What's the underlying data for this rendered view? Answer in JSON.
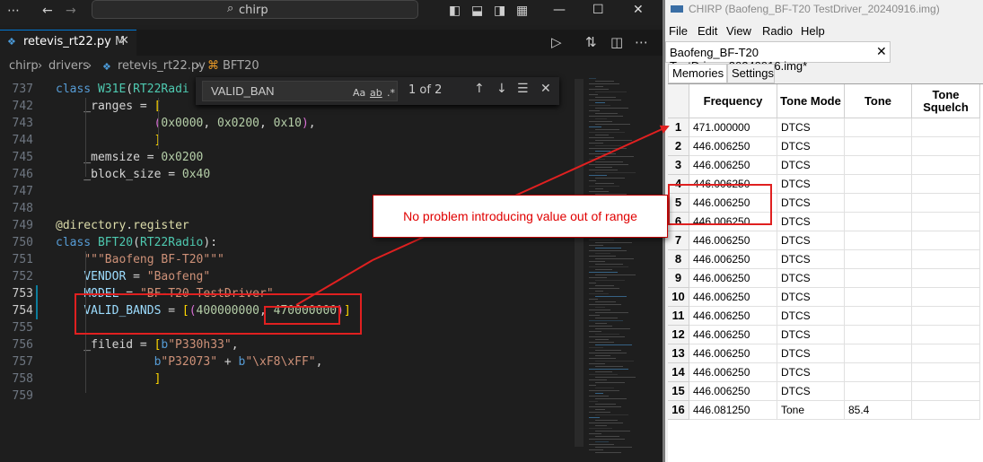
{
  "vscode": {
    "command_center": "chirp",
    "tab": {
      "name": "retevis_rt22.py",
      "modified": "M"
    },
    "breadcrumb": [
      "chirp",
      "drivers",
      "retevis_rt22.py",
      "BFT20"
    ],
    "find": {
      "value": "VALID_BAN",
      "opt_case": "Aa",
      "opt_word": "ab",
      "opt_regex": ".*",
      "count": "1 of 2"
    },
    "lines": [
      {
        "num": "737",
        "html": "<span class='k'>class</span> <span class='cl'>W31E</span>(<span class='cl'>RT22Radi</span>"
      },
      {
        "num": "742",
        "html": "    _ranges = <span class='y'>[</span>"
      },
      {
        "num": "743",
        "html": "              <span class='p'>(</span><span class='n'>0x0000</span>, <span class='n'>0x0200</span>, <span class='n'>0x10</span><span class='p'>)</span>,"
      },
      {
        "num": "744",
        "html": "              <span class='y'>]</span>"
      },
      {
        "num": "745",
        "html": "    _memsize = <span class='n'>0x0200</span>"
      },
      {
        "num": "746",
        "html": "    _block_size = <span class='n'>0x40</span>"
      },
      {
        "num": "747",
        "html": ""
      },
      {
        "num": "748",
        "html": ""
      },
      {
        "num": "749",
        "html": "<span class='dec'>@directory</span>.<span class='dec'>register</span>"
      },
      {
        "num": "750",
        "html": "<span class='k'>class</span> <span class='cl'>BFT20</span>(<span class='cl'>RT22Radio</span>):"
      },
      {
        "num": "751",
        "html": "    <span class='s'>\"\"\"Baofeng BF-T20\"\"\"</span>"
      },
      {
        "num": "752",
        "html": "    <span class='v'>VENDOR</span> = <span class='s'>\"Baofeng\"</span>"
      },
      {
        "num": "753",
        "html": "    <span class='v'>MODEL</span> = <span class='s'>\"BF-T20 TestDriver\"</span>"
      },
      {
        "num": "754",
        "html": "    <span class='v'>VALID_BANDS</span> = <span class='y'>[</span><span class='p'>(</span><span class='n'>400000000</span>, <span class='n'>470000000</span><span class='p'>)</span><span class='y'>]</span>"
      },
      {
        "num": "755",
        "html": ""
      },
      {
        "num": "756",
        "html": "    _fileid = <span class='y'>[</span><span class='k'>b</span><span class='s'>\"P330h33\"</span>,"
      },
      {
        "num": "757",
        "html": "              <span class='k'>b</span><span class='s'>\"P32073\"</span> + <span class='k'>b</span><span class='s'>\"\\xF8\\xFF\"</span>,"
      },
      {
        "num": "758",
        "html": "              <span class='y'>]</span>"
      },
      {
        "num": "759",
        "html": ""
      }
    ]
  },
  "callout": "No problem introducing value out of range",
  "chirp": {
    "window_title": "CHIRP (Baofeng_BF-T20 TestDriver_20240916.img)",
    "menu": [
      "File",
      "Edit",
      "View",
      "Radio",
      "Help"
    ],
    "file_tab": "Baofeng_BF-T20 TestDriver_20240916.img*",
    "subtabs": [
      "Memories",
      "Settings"
    ],
    "columns": [
      "Frequency",
      "Tone Mode",
      "Tone",
      "Tone Squelch"
    ],
    "rows": [
      {
        "n": "1",
        "freq": "471.000000",
        "mode": "DTCS",
        "tone": ""
      },
      {
        "n": "2",
        "freq": "446.006250",
        "mode": "DTCS",
        "tone": ""
      },
      {
        "n": "3",
        "freq": "446.006250",
        "mode": "DTCS",
        "tone": ""
      },
      {
        "n": "4",
        "freq": "446.006250",
        "mode": "DTCS",
        "tone": ""
      },
      {
        "n": "5",
        "freq": "446.006250",
        "mode": "DTCS",
        "tone": ""
      },
      {
        "n": "6",
        "freq": "446.006250",
        "mode": "DTCS",
        "tone": ""
      },
      {
        "n": "7",
        "freq": "446.006250",
        "mode": "DTCS",
        "tone": ""
      },
      {
        "n": "8",
        "freq": "446.006250",
        "mode": "DTCS",
        "tone": ""
      },
      {
        "n": "9",
        "freq": "446.006250",
        "mode": "DTCS",
        "tone": ""
      },
      {
        "n": "10",
        "freq": "446.006250",
        "mode": "DTCS",
        "tone": ""
      },
      {
        "n": "11",
        "freq": "446.006250",
        "mode": "DTCS",
        "tone": ""
      },
      {
        "n": "12",
        "freq": "446.006250",
        "mode": "DTCS",
        "tone": ""
      },
      {
        "n": "13",
        "freq": "446.006250",
        "mode": "DTCS",
        "tone": ""
      },
      {
        "n": "14",
        "freq": "446.006250",
        "mode": "DTCS",
        "tone": ""
      },
      {
        "n": "15",
        "freq": "446.006250",
        "mode": "DTCS",
        "tone": ""
      },
      {
        "n": "16",
        "freq": "446.081250",
        "mode": "Tone",
        "tone": "85.4"
      }
    ]
  },
  "colors": {
    "annotation_red": "#e02020",
    "vscode_bg": "#1e1e1e",
    "accent": "#0078d4"
  }
}
